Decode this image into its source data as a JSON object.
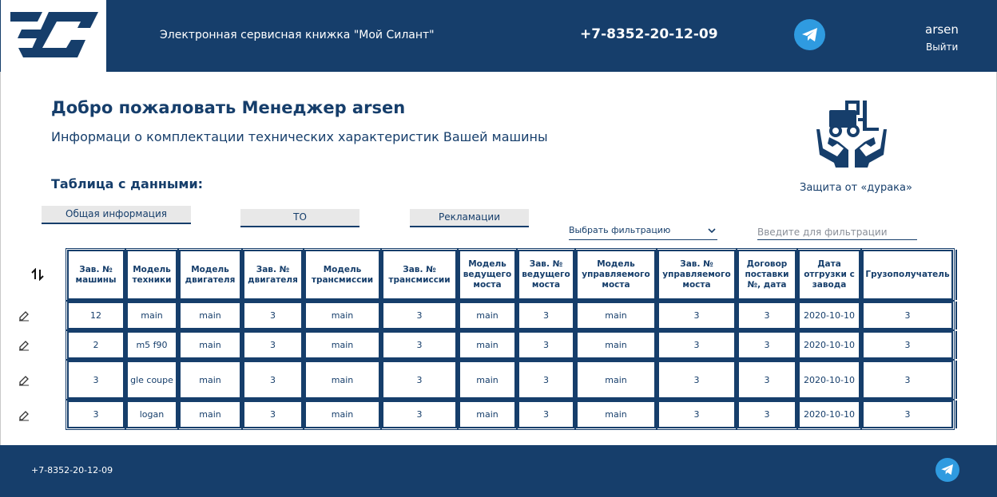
{
  "header": {
    "app_title": "Электронная сервисная книжка \"Мой Силант\"",
    "phone": "+7-8352-20-12-09",
    "username": "arsen",
    "logout_label": "Выйти"
  },
  "intro": {
    "welcome": "Добро пожаловать Менеджер arsen",
    "subtitle": "Информаци о комплектации технических характеристик Вашей машины",
    "table_caption": "Таблица с данными:",
    "promo_label": "Защита от «дурака»"
  },
  "tabs": [
    {
      "label": "Общая информация"
    },
    {
      "label": "ТО"
    },
    {
      "label": "Рекламации"
    }
  ],
  "filter": {
    "select_label": "Выбрать фильтрацию",
    "input_placeholder": "Введите для фильтрации"
  },
  "table": {
    "columns": [
      "Зав. № машины",
      "Модель техники",
      "Модель двигателя",
      "Зав. № двигателя",
      "Модель трансмиссии",
      "Зав. № трансмиссии",
      "Модель ведущего моста",
      "Зав. № ведущего моста",
      "Модель управляемого моста",
      "Зав. № управляемого моста",
      "Договор поставки №, дата",
      "Дата отгрузки с завода",
      "Грузополучатель"
    ],
    "rows": [
      [
        "12",
        "main",
        "main",
        "3",
        "main",
        "3",
        "main",
        "3",
        "main",
        "3",
        "3",
        "2020-10-10",
        "3"
      ],
      [
        "2",
        "m5 f90",
        "main",
        "3",
        "main",
        "3",
        "main",
        "3",
        "main",
        "3",
        "3",
        "2020-10-10",
        "3"
      ],
      [
        "3",
        "gle coupe",
        "main",
        "3",
        "main",
        "3",
        "main",
        "3",
        "main",
        "3",
        "3",
        "2020-10-10",
        "3"
      ],
      [
        "3",
        "logan",
        "main",
        "3",
        "main",
        "3",
        "main",
        "3",
        "main",
        "3",
        "3",
        "2020-10-10",
        "3"
      ]
    ]
  },
  "footer": {
    "phone": "+7-8352-20-12-09"
  },
  "colors": {
    "brand": "#163e6b",
    "telegram": "#2f9be0",
    "tab_bg": "#e8e8e8"
  },
  "icons": [
    "logo",
    "telegram-icon",
    "forklift-hands-icon",
    "sort-icon",
    "edit-icon",
    "chevron-down-icon"
  ]
}
